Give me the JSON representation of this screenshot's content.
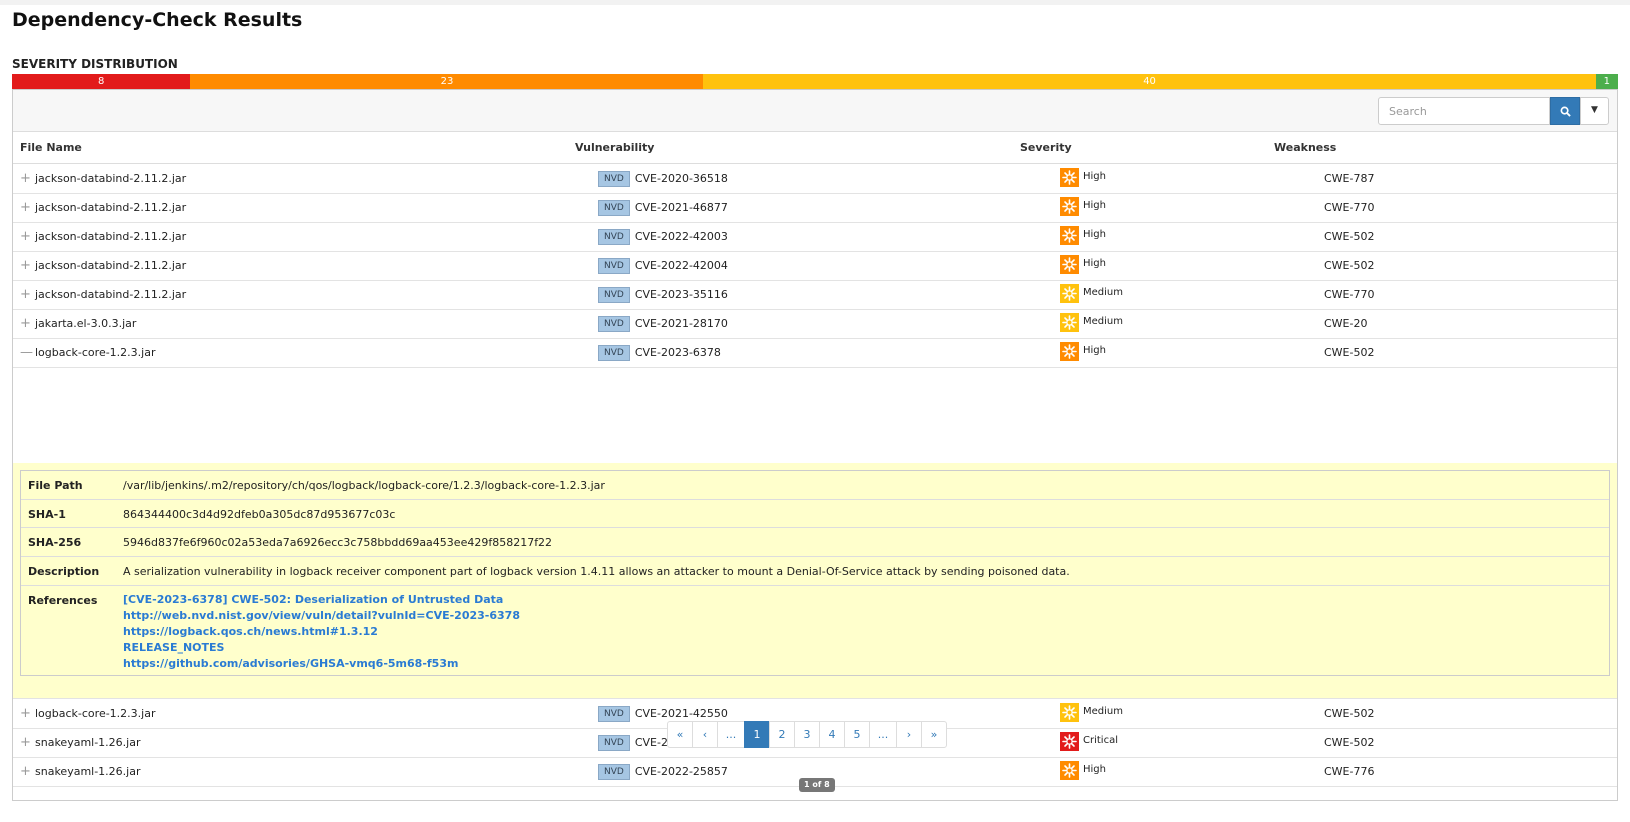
{
  "page_title": "Dependency-Check Results",
  "severity_section_title": "SEVERITY DISTRIBUTION",
  "severity_distribution": [
    {
      "label": "8",
      "value": 8,
      "color": "#e21b1b"
    },
    {
      "label": "23",
      "value": 23,
      "color": "#ff8b00"
    },
    {
      "label": "40",
      "value": 40,
      "color": "#ffc20e"
    },
    {
      "label": "1",
      "value": 1,
      "color": "#4cae4c"
    }
  ],
  "search": {
    "placeholder": "Search"
  },
  "table": {
    "headers": {
      "file_name": "File Name",
      "vulnerability": "Vulnerability",
      "severity": "Severity",
      "weakness": "Weakness"
    },
    "rows": [
      {
        "toggle": "+",
        "file": "jackson-databind-2.11.2.jar",
        "source": "NVD",
        "cve": "CVE-2020-36518",
        "severity": "High",
        "severity_color": "#ff8b00",
        "weakness": "CWE-787"
      },
      {
        "toggle": "+",
        "file": "jackson-databind-2.11.2.jar",
        "source": "NVD",
        "cve": "CVE-2021-46877",
        "severity": "High",
        "severity_color": "#ff8b00",
        "weakness": "CWE-770"
      },
      {
        "toggle": "+",
        "file": "jackson-databind-2.11.2.jar",
        "source": "NVD",
        "cve": "CVE-2022-42003",
        "severity": "High",
        "severity_color": "#ff8b00",
        "weakness": "CWE-502"
      },
      {
        "toggle": "+",
        "file": "jackson-databind-2.11.2.jar",
        "source": "NVD",
        "cve": "CVE-2022-42004",
        "severity": "High",
        "severity_color": "#ff8b00",
        "weakness": "CWE-502"
      },
      {
        "toggle": "+",
        "file": "jackson-databind-2.11.2.jar",
        "source": "NVD",
        "cve": "CVE-2023-35116",
        "severity": "Medium",
        "severity_color": "#ffc20e",
        "weakness": "CWE-770"
      },
      {
        "toggle": "+",
        "file": "jakarta.el-3.0.3.jar",
        "source": "NVD",
        "cve": "CVE-2021-28170",
        "severity": "Medium",
        "severity_color": "#ffc20e",
        "weakness": "CWE-20"
      },
      {
        "toggle": "—",
        "file": "logback-core-1.2.3.jar",
        "source": "NVD",
        "cve": "CVE-2023-6378",
        "severity": "High",
        "severity_color": "#ff8b00",
        "weakness": "CWE-502"
      },
      {
        "toggle": "+",
        "file": "logback-core-1.2.3.jar",
        "source": "NVD",
        "cve": "CVE-2021-42550",
        "severity": "Medium",
        "severity_color": "#ffc20e",
        "weakness": "CWE-502"
      },
      {
        "toggle": "+",
        "file": "snakeyaml-1.26.jar",
        "source": "NVD",
        "cve": "CVE-2022-1471",
        "severity": "Critical",
        "severity_color": "#e21b1b",
        "weakness": "CWE-502"
      },
      {
        "toggle": "+",
        "file": "snakeyaml-1.26.jar",
        "source": "NVD",
        "cve": "CVE-2022-25857",
        "severity": "High",
        "severity_color": "#ff8b00",
        "weakness": "CWE-776"
      }
    ]
  },
  "detail": {
    "file_path_label": "File Path",
    "file_path": "/var/lib/jenkins/.m2/repository/ch/qos/logback/logback-core/1.2.3/logback-core-1.2.3.jar",
    "sha1_label": "SHA-1",
    "sha1": "864344400c3d4d92dfeb0a305dc87d953677c03c",
    "sha256_label": "SHA-256",
    "sha256": "5946d837fe6f960c02a53eda7a6926ecc3c758bbdd69aa453ee429f858217f22",
    "description_label": "Description",
    "description": "A serialization vulnerability in logback receiver component part of logback version 1.4.11 allows an attacker to mount a Denial-Of-Service attack by sending poisoned data.",
    "references_label": "References",
    "references": [
      "[CVE-2023-6378] CWE-502: Deserialization of Untrusted Data",
      "http://web.nvd.nist.gov/view/vuln/detail?vulnId=CVE-2023-6378",
      "https://logback.qos.ch/news.html#1.3.12",
      "RELEASE_NOTES",
      "https://github.com/advisories/GHSA-vmq6-5m68-f53m"
    ]
  },
  "pagination": {
    "buttons": [
      "«",
      "‹",
      "...",
      "1",
      "2",
      "3",
      "4",
      "5",
      "...",
      "›",
      "»"
    ],
    "active": "1",
    "info": "1 of 8"
  },
  "icons": {
    "search": "search-icon",
    "dropdown": "caret-down-icon",
    "severity": "severity-burst-icon",
    "expand": "plus-icon",
    "collapse": "minus-icon"
  }
}
